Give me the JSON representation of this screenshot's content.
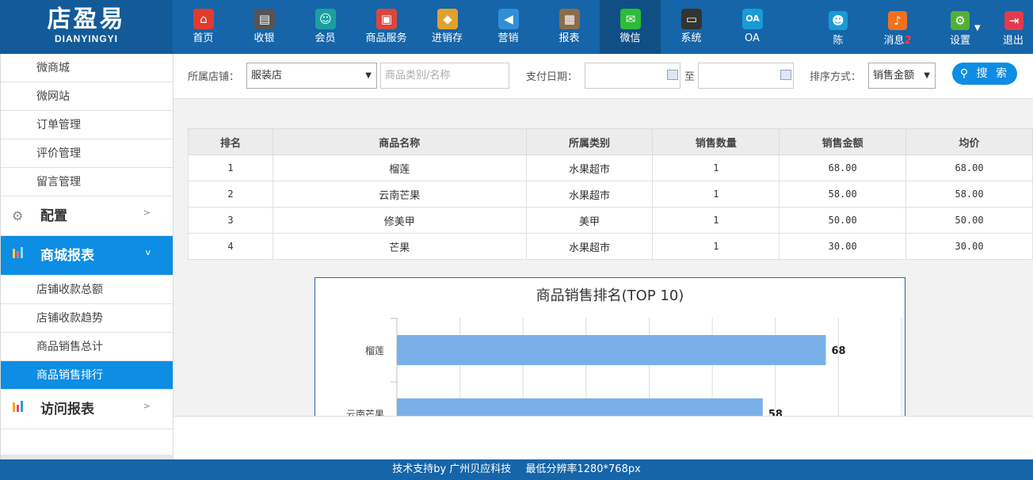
{
  "brand": {
    "name_cn": "店盈易",
    "name_en": "DIANYINGYI"
  },
  "nav": [
    {
      "label": "首页",
      "icon": "home-icon",
      "color": "#e23b2e",
      "glyph": "⌂"
    },
    {
      "label": "收银",
      "icon": "cash-register-icon",
      "color": "#555555",
      "glyph": "▤"
    },
    {
      "label": "会员",
      "icon": "member-icon",
      "color": "#1aa0a0",
      "glyph": "☺"
    },
    {
      "label": "商品服务",
      "icon": "goods-icon",
      "color": "#d8473f",
      "glyph": "▣"
    },
    {
      "label": "进销存",
      "icon": "inventory-icon",
      "color": "#e2a12b",
      "glyph": "◆"
    },
    {
      "label": "营销",
      "icon": "marketing-icon",
      "color": "#2f8fd8",
      "glyph": "◀"
    },
    {
      "label": "报表",
      "icon": "report-icon",
      "color": "#8a6d4a",
      "glyph": "▦"
    },
    {
      "label": "微信",
      "icon": "wechat-icon",
      "color": "#2dbb3a",
      "glyph": "✉"
    },
    {
      "label": "系统",
      "icon": "monitor-icon",
      "color": "#333333",
      "glyph": "▭"
    },
    {
      "label": "OA",
      "icon": "oa-icon",
      "color": "#1a9ad6",
      "glyph": "OA"
    }
  ],
  "user_nav": [
    {
      "label": "陈",
      "icon": "user-icon",
      "color": "#1a9ad6",
      "glyph": "☻"
    },
    {
      "label": "消息",
      "badge": "2",
      "icon": "bell-icon",
      "color": "#f07020",
      "glyph": "♪"
    },
    {
      "label": "设置",
      "icon": "gear-icon",
      "color": "#52b035",
      "glyph": "⚙"
    },
    {
      "label": "退出",
      "icon": "logout-icon",
      "color": "#e23b4e",
      "glyph": "⇥"
    }
  ],
  "sidebar": {
    "top_items": [
      "微商城",
      "微网站",
      "订单管理",
      "评价管理",
      "留言管理"
    ],
    "config_group": "配置",
    "report_group": "商城报表",
    "report_items": [
      "店铺收款总额",
      "店铺收款趋势",
      "商品销售总计",
      "商品销售排行"
    ],
    "visit_group": "访问报表"
  },
  "filters": {
    "store_label": "所属店铺：",
    "store_value": "服装店",
    "category_placeholder": "商品类别/名称",
    "date_label": "支付日期：",
    "date_to": "至",
    "sort_label": "排序方式：",
    "sort_value": "销售金额",
    "search_label": "搜 索"
  },
  "table": {
    "headers": [
      "排名",
      "商品名称",
      "所属类别",
      "销售数量",
      "销售金额",
      "均价"
    ],
    "rows": [
      [
        "1",
        "榴莲",
        "水果超市",
        "1",
        "68.00",
        "68.00"
      ],
      [
        "2",
        "云南芒果",
        "水果超市",
        "1",
        "58.00",
        "58.00"
      ],
      [
        "3",
        "修美甲",
        "美甲",
        "1",
        "50.00",
        "50.00"
      ],
      [
        "4",
        "芒果",
        "水果超市",
        "1",
        "30.00",
        "30.00"
      ]
    ]
  },
  "chart_data": {
    "type": "bar",
    "orientation": "horizontal",
    "title": "商品销售排名(TOP 10)",
    "categories": [
      "榴莲",
      "云南芒果"
    ],
    "values": [
      68,
      58
    ],
    "xlim": [
      0,
      80
    ],
    "grid": true,
    "bar_color": "#7ab0e8"
  },
  "footer": {
    "support": "技术支持by 广州贝应科技",
    "resolution": "最低分辨率1280*768px"
  }
}
